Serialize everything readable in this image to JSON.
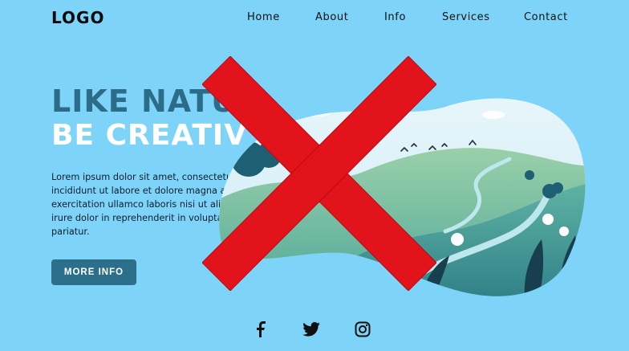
{
  "brand": {
    "logo_text": "LOGO"
  },
  "nav": {
    "items": [
      {
        "label": "Home"
      },
      {
        "label": "About"
      },
      {
        "label": "Info"
      },
      {
        "label": "Services"
      },
      {
        "label": "Contact"
      }
    ]
  },
  "hero": {
    "title_line_1": "LIKE NATU",
    "title_line_2": "BE CREATIV",
    "body": "Lorem ipsum dolor sit amet, consectetur adipiscing elit, sed do eiusmod tempor incididunt ut labore et dolore magna aliqua. Ut enim ad minim veniam, quis nostrud exercitation ullamco laboris nisi ut aliquip ex ea commodo consequat. Duis aute irure dolor in reprehenderit in voluptate velit esse cillum dolore eu fugiat nulla pariatur.",
    "cta_label": "MORE INFO"
  },
  "social": {
    "icons": [
      "facebook-icon",
      "twitter-icon",
      "instagram-icon"
    ]
  },
  "colors": {
    "page_background": "#7dd4f8",
    "title_blue": "#2c6c89",
    "button_bg": "#2b6f8b",
    "cross_red": "#e3131b"
  }
}
